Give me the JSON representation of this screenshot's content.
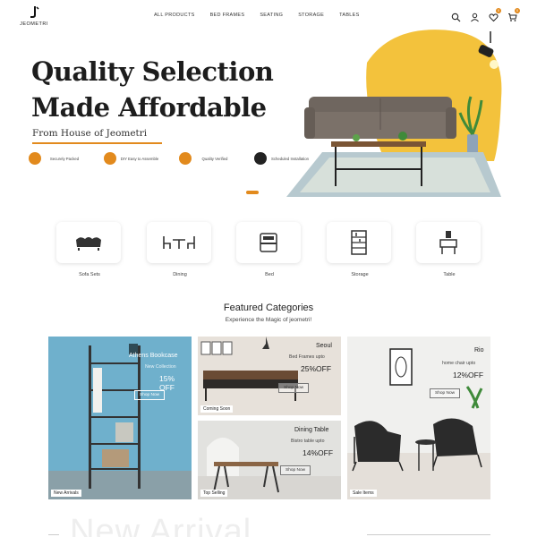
{
  "brand": {
    "name": "JEOMETRI"
  },
  "nav": {
    "items": [
      "ALL PRODUCTS",
      "BED FRAMES",
      "SEATING",
      "STORAGE",
      "TABLES"
    ]
  },
  "header": {
    "wishlist_count": "0",
    "cart_count": "0"
  },
  "hero": {
    "title_line1": "Quality Selection",
    "title_line2": "Made Affordable",
    "subtitle": "From House of Jeometri",
    "features": [
      {
        "icon": "box-icon",
        "text": "Securely Packed"
      },
      {
        "icon": "tools-icon",
        "text": "DIY Easy to Assemble"
      },
      {
        "icon": "badge-icon",
        "text": "Quality Verified"
      },
      {
        "icon": "wrench-icon",
        "text": "Scheduled Installation"
      }
    ]
  },
  "categories": [
    {
      "icon": "sofa-icon",
      "label": "Sofa Sets"
    },
    {
      "icon": "dining-icon",
      "label": "Dining"
    },
    {
      "icon": "bed-icon",
      "label": "Bed"
    },
    {
      "icon": "storage-icon",
      "label": "Storage"
    },
    {
      "icon": "table-icon",
      "label": "Table"
    }
  ],
  "featured": {
    "title": "Featured Categories",
    "subtitle": "Experience the Magic of jeometri!",
    "cards": {
      "athens": {
        "title": "Athens Bookcase",
        "sub": "New Collection",
        "discount": "15% OFF",
        "button": "Shop Now",
        "tag": "New Arrivals"
      },
      "seoul": {
        "title": "Seoul",
        "sub": "Bed Frames upto",
        "discount": "25%OFF",
        "button": "Shop Now",
        "tag": "Coming Soon"
      },
      "dining": {
        "title": "Dining Table",
        "sub": "Bistro table upto",
        "discount": "14%OFF",
        "button": "Shop Now",
        "tag": "Top Selling"
      },
      "rio": {
        "title": "Rio",
        "sub": "home chair upto",
        "discount": "12%OFF",
        "button": "Shop Now",
        "tag": "Sale Items"
      }
    }
  },
  "new_arrival": {
    "heading": "New Arrival"
  },
  "colors": {
    "accent": "#e28a1d",
    "hero_blob": "#f3c23c"
  }
}
